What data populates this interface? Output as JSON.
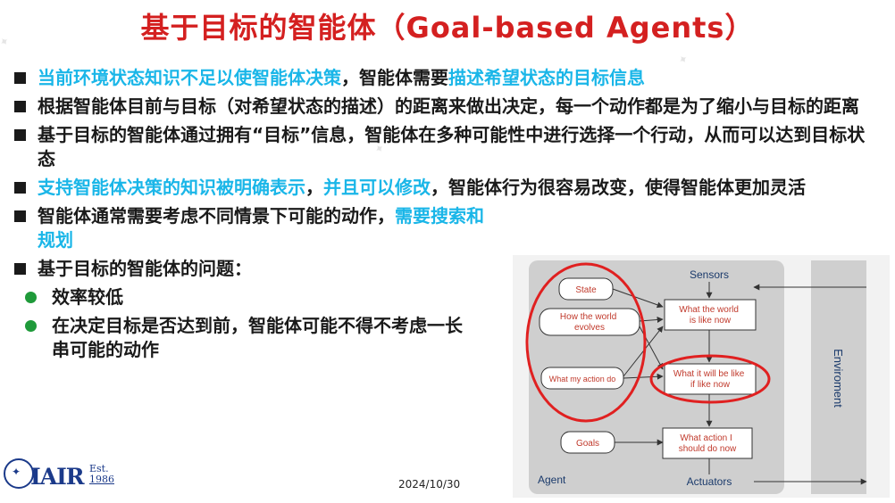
{
  "title": "基于目标的智能体（Goal-based Agents）",
  "bullets": [
    {
      "parts": [
        {
          "text": "当前环境状态知识不足以使智能体决策",
          "hl": true
        },
        {
          "text": "，智能体需要",
          "hl": false
        },
        {
          "text": "描述希望状态的目标信息",
          "hl": true
        }
      ]
    },
    {
      "parts": [
        {
          "text": "根据智能体目前与目标（对希望状态的描述）的距离来做出决定，每一个动作都是为了缩小与目标的距离",
          "hl": false
        }
      ]
    },
    {
      "parts": [
        {
          "text": "基于目标的智能体通过拥有“目标”信息，智能体在多种可能性中进行选择一个行动，从而可以达到目标状态",
          "hl": false
        }
      ]
    },
    {
      "parts": [
        {
          "text": "支持智能体决策的知识被明确表示",
          "hl": true
        },
        {
          "text": "，",
          "hl": false
        },
        {
          "text": "并且可以修改",
          "hl": true
        },
        {
          "text": "，智能体行为很容易改变，使得智能体更加灵活",
          "hl": false
        }
      ]
    },
    {
      "parts": [
        {
          "text": "智能体通常需要考虑不同情景下可能的动作，",
          "hl": false
        },
        {
          "text": "需要搜索和规划",
          "hl": true
        }
      ]
    },
    {
      "parts": [
        {
          "text": "基于目标的智能体的问题：",
          "hl": false
        }
      ]
    }
  ],
  "sub_bullets": [
    "效率较低",
    "在决定目标是否达到前，智能体可能不得不考虑一长串可能的动作"
  ],
  "date": "2024/10/30",
  "logo": {
    "name": "IAIR",
    "est_label": "Est.",
    "est_year": "1986"
  },
  "diagram": {
    "sensors": "Sensors",
    "actuators": "Actuators",
    "agent": "Agent",
    "environment": "Enviroment",
    "state": "State",
    "world_evolves": [
      "How the world",
      "evolves"
    ],
    "my_action": "What my action do",
    "world_now": [
      "What the world",
      "is like now"
    ],
    "will_be": [
      "What it will  be like",
      "if like now"
    ],
    "goals": "Goals",
    "action_now": [
      "What action I",
      "should do now"
    ]
  },
  "colors": {
    "title": "#d42020",
    "highlight": "#1ab6e8",
    "diagram_text": "#c0392b",
    "circle": "#e02020",
    "logo": "#1b3a8a"
  }
}
